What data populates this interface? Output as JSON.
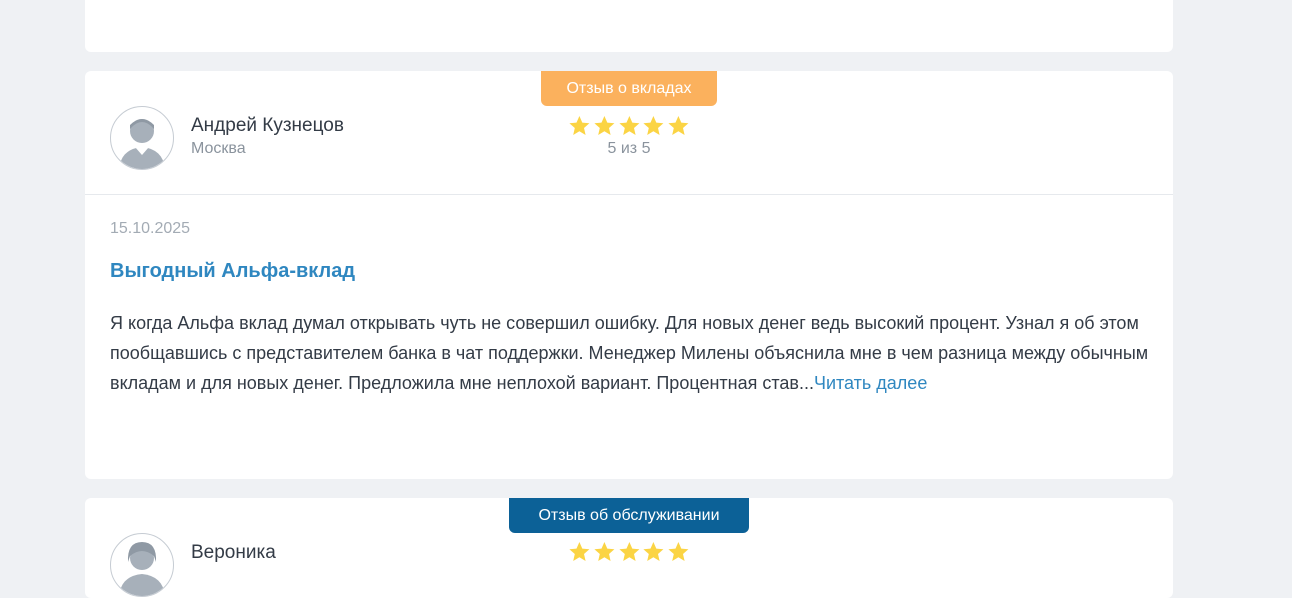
{
  "colors": {
    "page_background": "#eff1f4",
    "card_background": "#ffffff",
    "badge_deposits": "#fbb15d",
    "badge_service": "#0c6197",
    "link": "#2f87c0",
    "star": "#fbd444",
    "muted_text": "#8a939d"
  },
  "reviews": [
    {
      "badge": "Отзыв о вкладах",
      "author": {
        "name": "Андрей Кузнецов",
        "city": "Москва",
        "avatar_icon": "user-avatar-icon"
      },
      "rating": {
        "value": 5,
        "max": 5,
        "label": "5 из 5"
      },
      "date": "15.10.2025",
      "title": "Выгодный Альфа-вклад",
      "text": "Я когда Альфа вклад думал открывать чуть не совершил ошибку. Для новых денег ведь высокий процент. Узнал я об этом пообщавшись с представителем банка в чат поддержки. Менеджер Милены объяснила мне в чем разница между обычным вкладам и для новых денег. Предложила мне неплохой вариант. Процентная став...",
      "read_more": "Читать далее"
    },
    {
      "badge": "Отзыв об обслуживании",
      "author": {
        "name": "Вероника",
        "city": "",
        "avatar_icon": "user-avatar-icon"
      },
      "rating": {
        "value": 5,
        "max": 5
      }
    }
  ]
}
